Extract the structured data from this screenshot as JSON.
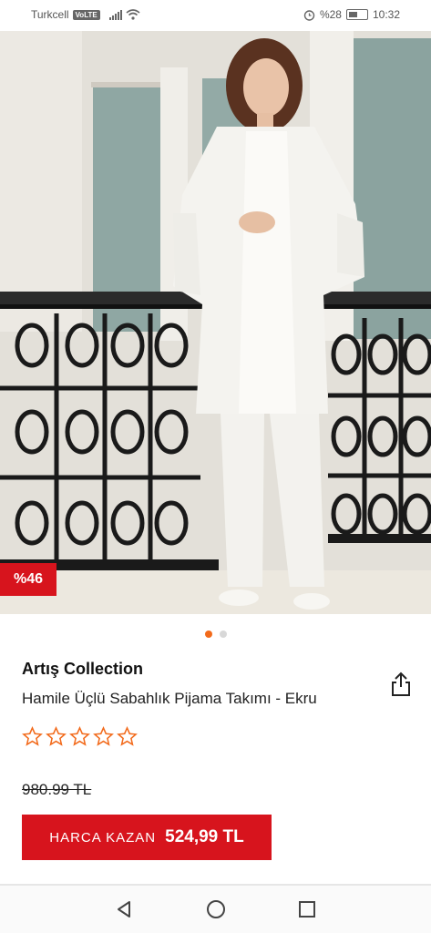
{
  "status_bar": {
    "carrier": "Turkcell",
    "network_badge": "VoLTE",
    "battery_percent": "%28",
    "time": "10:32",
    "icons": [
      "signal-icon",
      "wifi-icon",
      "alarm-icon",
      "battery-icon"
    ]
  },
  "product": {
    "discount_badge": "%46",
    "image_count": 2,
    "active_image": 1,
    "brand": "Artış Collection",
    "name": "Hamile Üçlü Sabahlık Pijama Takımı - Ekru",
    "rating_stars_filled": 0,
    "rating_stars_total": 5,
    "old_price": "980.99 TL",
    "cta_label": "HARCA KAZAN",
    "cta_price": "524,99 TL"
  },
  "colors": {
    "accent_red": "#d7141d",
    "active_dot": "#f26a1b",
    "star_outline": "#f26a1b"
  },
  "nav_bar": {
    "icons": [
      "back-icon",
      "home-icon",
      "recents-icon"
    ]
  }
}
